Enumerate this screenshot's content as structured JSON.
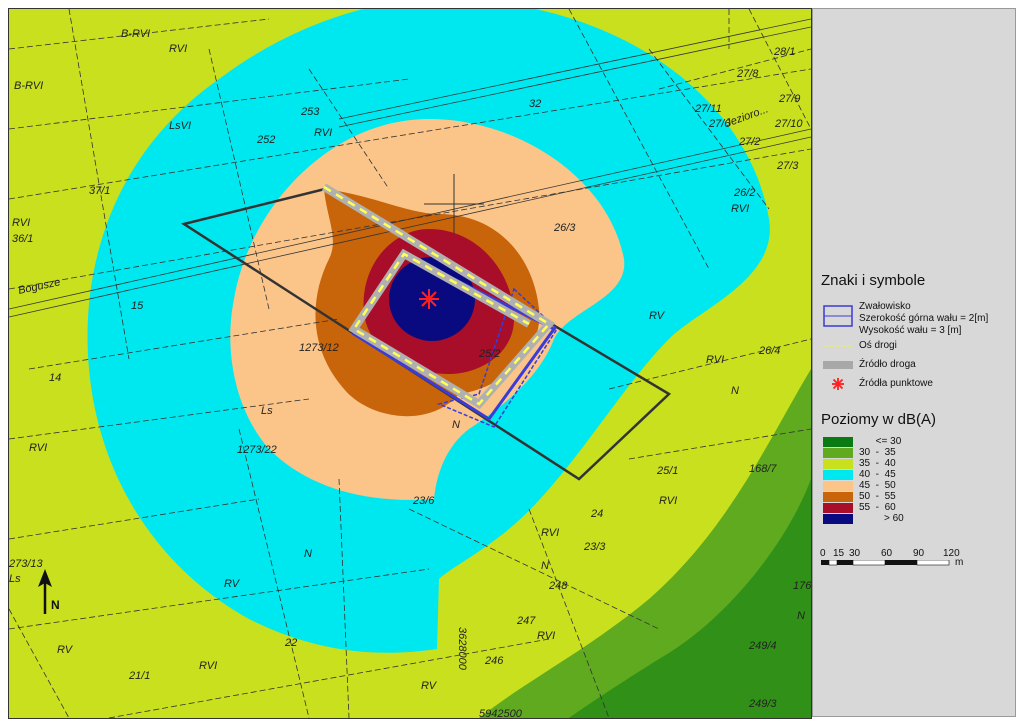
{
  "map": {
    "colors": {
      "le30": "#0a7a12",
      "30_35": "#5faa1e",
      "35_40": "#c8e01e",
      "40_45": "#00e8ef",
      "45_50": "#fbc589",
      "50_55": "#c8640a",
      "55_60": "#a80d2a",
      "gt60": "#0a0a80"
    },
    "parcels": [
      "B-RVI",
      "RVI",
      "B-RVI",
      "LsVI",
      "252",
      "253",
      "RVI",
      "32",
      "28/1",
      "27/8",
      "27/9",
      "27/10",
      "27/6",
      "27/11",
      "27/2",
      "27/3",
      "26/2",
      "RVI",
      "26/3",
      "37/1",
      "RVI",
      "36/1",
      "15",
      "14",
      "RVI",
      "1273/12",
      "25/2",
      "RV",
      "26/4",
      "RVI",
      "N",
      "N",
      "25/1",
      "RVI",
      "168/7",
      "Ls",
      "1273/22",
      "23/6",
      "24",
      "23/3",
      "RVI",
      "N",
      "248",
      "273/13",
      "Ls",
      "N",
      "RV",
      "247",
      "RVI",
      "22",
      "246",
      "RVI",
      "21/1",
      "RV",
      "RV",
      "249/4",
      "249/3",
      "176",
      "N"
    ],
    "road_labels": [
      "Bogusze",
      "Jezioro..."
    ],
    "grid_label_vertical": "3628000",
    "grid_label_horizontal": "5942500"
  },
  "legend": {
    "title_symbols": "Znaki i symbole",
    "embankment": {
      "name": "Zwałowisko",
      "width_label": "Szerokość górna wału = 2[m]",
      "height_label": "Wysokość wału = 3 [m]"
    },
    "road_axis": "Oś drogi",
    "road_source": "Źródło droga",
    "point_sources": "Źródła punktowe",
    "title_levels": "Poziomy w dB(A)",
    "levels": [
      {
        "label": "      <= 30",
        "color": "#0a7a12"
      },
      {
        "label": "30  -  35",
        "color": "#5faa1e"
      },
      {
        "label": "35  -  40",
        "color": "#c8e01e"
      },
      {
        "label": "40  -  45",
        "color": "#00e8ef"
      },
      {
        "label": "45  -  50",
        "color": "#fbc589"
      },
      {
        "label": "50  -  55",
        "color": "#c8640a"
      },
      {
        "label": "55  -  60",
        "color": "#a80d2a"
      },
      {
        "label": "         > 60",
        "color": "#0a0a80"
      }
    ],
    "scale_ticks": [
      "0",
      "15",
      "30",
      "60",
      "90",
      "120"
    ],
    "scale_unit": "m"
  },
  "north_arrow_label": "N"
}
